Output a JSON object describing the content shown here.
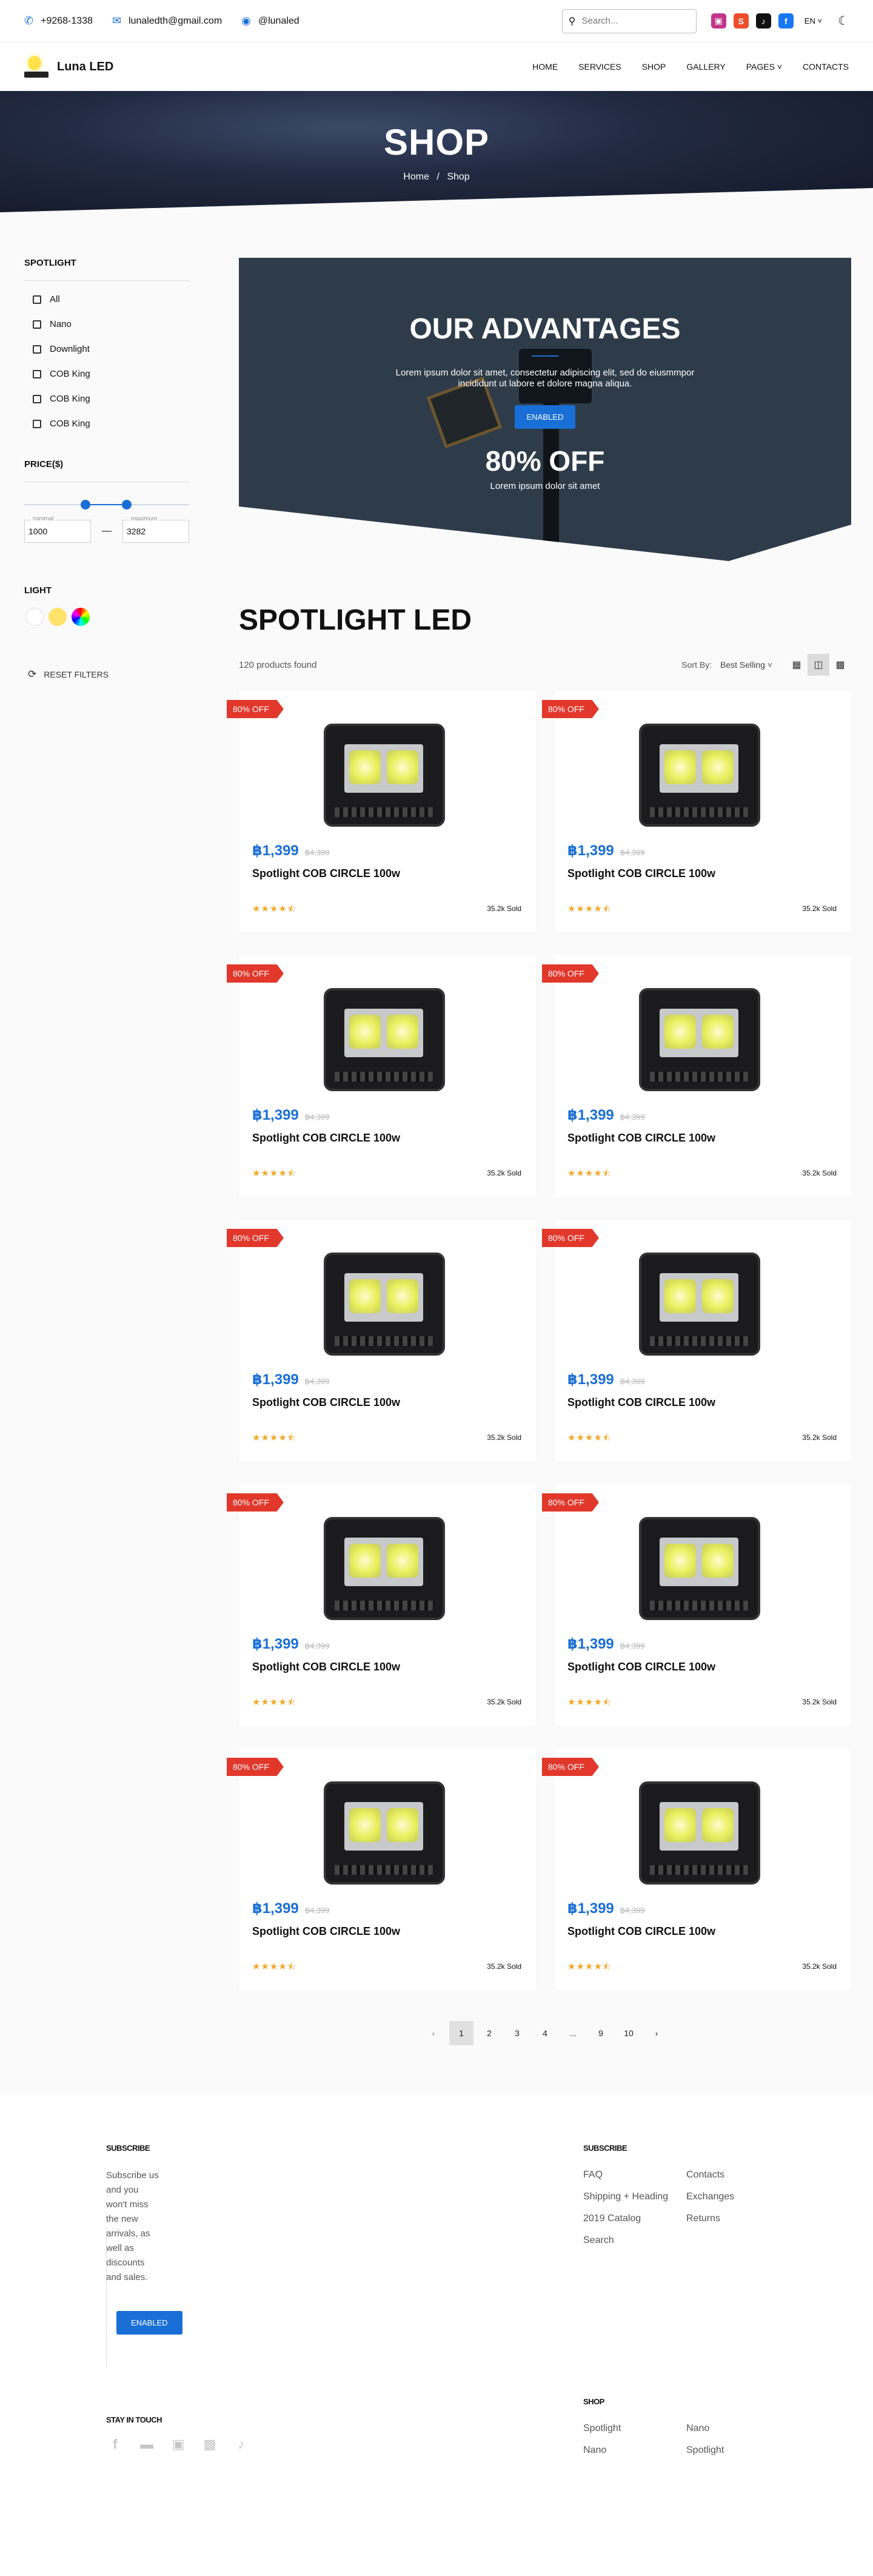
{
  "topbar": {
    "phone": "+9268-1338",
    "email": "lunaledth@gmail.com",
    "messenger": "@lunaled",
    "search_placeholder": "Search...",
    "lang": "EN",
    "icons": [
      "phone-icon",
      "mail-icon",
      "messenger-icon",
      "search-icon",
      "instagram-icon",
      "shopee-icon",
      "tiktok-icon",
      "facebook-icon",
      "moon-icon"
    ]
  },
  "nav": {
    "brand": "Luna LED",
    "items": [
      "HOME",
      "SERVICES",
      "SHOP",
      "GALLERY",
      "PAGES",
      "CONTACTS"
    ]
  },
  "hero": {
    "title": "SHOP",
    "breadcrumb": [
      "Home",
      "/",
      "Shop"
    ]
  },
  "sidebar": {
    "spotlight_title": "SPOTLIGHT",
    "categories": [
      "All",
      "Nano",
      "Downlight",
      "COB King",
      "COB King",
      "COB King"
    ],
    "price_title": "PRICE($)",
    "price_range": {
      "min_fraction": 0.37,
      "max_fraction": 0.62
    },
    "min_label": "minimal",
    "min_value": "1000",
    "max_label": "maximum",
    "max_value": "3282",
    "dash": "—",
    "light_title": "LIGHT",
    "light_colors": [
      "#ffffff",
      "#ffe26a",
      "multicolor"
    ],
    "reset": "RESET FILTERS"
  },
  "promo": {
    "title": "OUR ADVANTAGES",
    "text": "Lorem ipsum dolor sit amet, consectetur adipiscing elit, sed do eiusmmpor incididunt ut labore et dolore magna aliqua.",
    "button": "ENABLED",
    "offer": "80% OFF",
    "subtext": "Lorem ipsum dolor sit amet"
  },
  "catalog": {
    "title": "SPOTLIGHT LED",
    "count": "120 products found",
    "sort_label": "Sort By:",
    "sort_value": "Best Selling",
    "products": [
      {
        "badge": "80% OFF",
        "price": "฿1,399",
        "old_price": "฿4,399",
        "name": "Spotlight COB CIRCLE 100w",
        "rating": 4.5,
        "sold": "35.2k Sold"
      },
      {
        "badge": "80% OFF",
        "price": "฿1,399",
        "old_price": "฿4,399",
        "name": "Spotlight COB CIRCLE 100w",
        "rating": 4.5,
        "sold": "35.2k Sold"
      },
      {
        "badge": "80% OFF",
        "price": "฿1,399",
        "old_price": "฿4,399",
        "name": "Spotlight COB CIRCLE 100w",
        "rating": 4.5,
        "sold": "35.2k Sold"
      },
      {
        "badge": "80% OFF",
        "price": "฿1,399",
        "old_price": "฿4,399",
        "name": "Spotlight COB CIRCLE 100w",
        "rating": 4.5,
        "sold": "35.2k Sold"
      },
      {
        "badge": "80% OFF",
        "price": "฿1,399",
        "old_price": "฿4,399",
        "name": "Spotlight COB CIRCLE 100w",
        "rating": 4.5,
        "sold": "35.2k Sold"
      },
      {
        "badge": "80% OFF",
        "price": "฿1,399",
        "old_price": "฿4,399",
        "name": "Spotlight COB CIRCLE 100w",
        "rating": 4.5,
        "sold": "35.2k Sold"
      },
      {
        "badge": "80% OFF",
        "price": "฿1,399",
        "old_price": "฿4,399",
        "name": "Spotlight COB CIRCLE 100w",
        "rating": 4.5,
        "sold": "35.2k Sold"
      },
      {
        "badge": "80% OFF",
        "price": "฿1,399",
        "old_price": "฿4,399",
        "name": "Spotlight COB CIRCLE 100w",
        "rating": 4.5,
        "sold": "35.2k Sold"
      },
      {
        "badge": "80% OFF",
        "price": "฿1,399",
        "old_price": "฿4,399",
        "name": "Spotlight COB CIRCLE 100w",
        "rating": 4.5,
        "sold": "35.2k Sold"
      },
      {
        "badge": "80% OFF",
        "price": "฿1,399",
        "old_price": "฿4,399",
        "name": "Spotlight COB CIRCLE 100w",
        "rating": 4.5,
        "sold": "35.2k Sold"
      }
    ],
    "pages": [
      "1",
      "2",
      "3",
      "4",
      "...",
      "9",
      "10"
    ],
    "current_page": "1"
  },
  "footer": {
    "subscribe_title": "SUBSCRIBE",
    "subscribe_text": "Subscribe us and you won't miss the new arrivals, as well as discounts and sales.",
    "button": "ENABLED",
    "links_title": "SUBSCRIBE",
    "links": [
      "FAQ",
      "Contacts",
      "Shipping + Heading",
      "Exchanges",
      "2019 Catalog",
      "Returns",
      "Search"
    ],
    "stay_title": "STAY IN TOUCH",
    "social_icons": [
      "facebook-icon",
      "line-icon",
      "shopee-icon",
      "messenger-icon",
      "tiktok-icon"
    ],
    "shop_title": "SHOP",
    "shop_links": [
      "Spotlight",
      "Nano",
      "Nano",
      "Spotlight"
    ]
  },
  "colors": {
    "accent": "#1a6fd6",
    "badge": "#e2372b",
    "star": "#f5a623"
  }
}
